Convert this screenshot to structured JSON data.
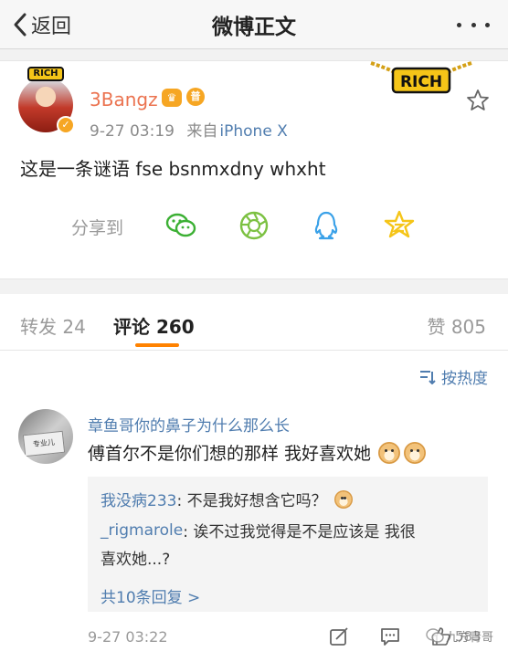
{
  "navbar": {
    "back_label": "返回",
    "title": "微博正文"
  },
  "post": {
    "avatar_badge": "RICH",
    "chain_text": "RICH",
    "username": "3Bangz",
    "vip_label": "普",
    "time": "9-27 03:19",
    "source_prefix": "来自",
    "source": "iPhone X",
    "text": "这是一条谜语 fse bsnmxdny whxht",
    "share_label": "分享到",
    "share_icons": [
      "wechat-icon",
      "moments-icon",
      "qq-icon",
      "qzone-icon"
    ]
  },
  "tabs": {
    "repost": "转发 24",
    "comments": "评论 260",
    "likes": "赞 805"
  },
  "comments": {
    "sort_label": "按热度",
    "items": [
      {
        "author": "章鱼哥你的鼻子为什么那么长",
        "avatar_sign": "专业儿",
        "body": "傅首尔不是你们想的那样 我好喜欢她",
        "replies": [
          {
            "who": "我没病233",
            "text": ": 不是我好想含它吗？"
          },
          {
            "who": "_rigmarole",
            "text": ": 诶不过我觉得是不是应该是 我很"
          },
          {
            "who": "",
            "text": "喜欢她...?"
          }
        ],
        "more_replies": "共10条回复 >",
        "time": "9-27 03:22",
        "like_count": "583"
      }
    ]
  },
  "watermark": {
    "text": "九方青哥"
  },
  "colors": {
    "accent_orange": "#ff8200",
    "username_orange": "#eb7350",
    "link_blue": "#507daf",
    "wechat_green": "#3cb034",
    "moments_green": "#7cc142",
    "qq_blue": "#3aa1e8",
    "qzone_yellow": "#f5c518"
  }
}
